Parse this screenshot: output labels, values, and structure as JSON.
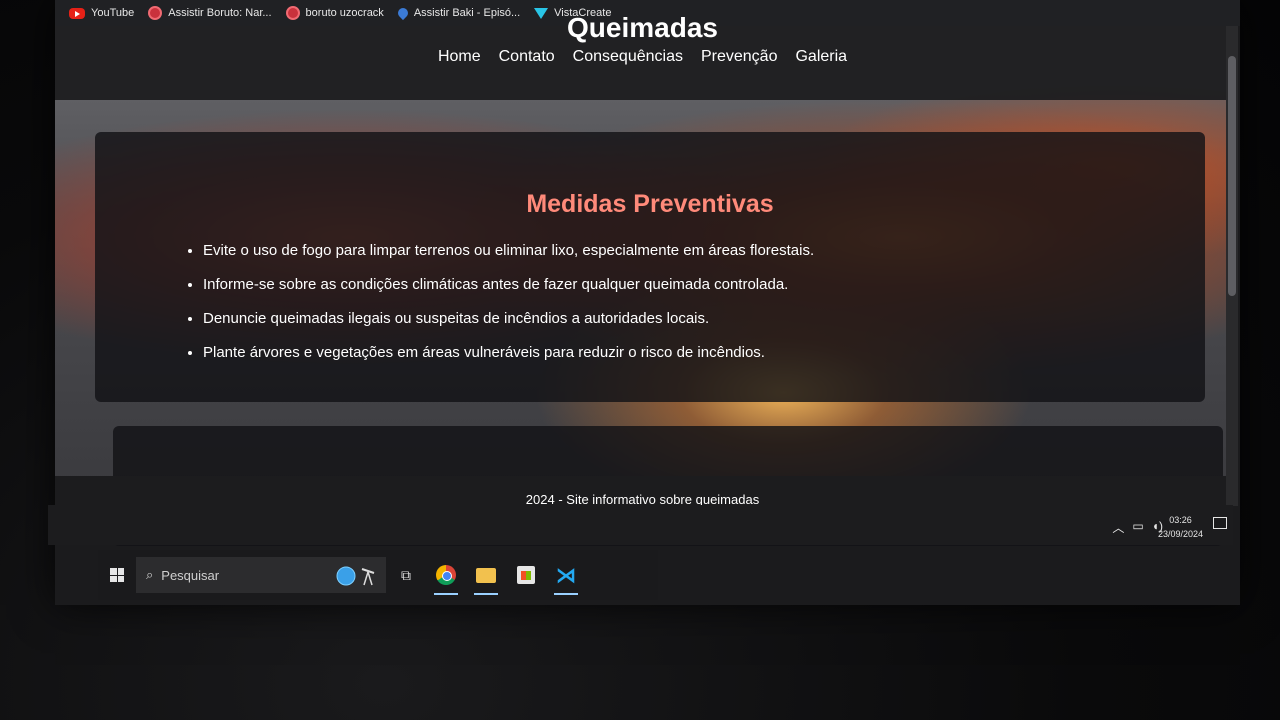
{
  "bookmarks": [
    {
      "label": "YouTube",
      "icon": "youtube-icon"
    },
    {
      "label": "Assistir Boruto: Nar...",
      "icon": "site-icon"
    },
    {
      "label": "boruto uzocrack",
      "icon": "site-icon"
    },
    {
      "label": "Assistir Baki - Episó...",
      "icon": "site-icon"
    },
    {
      "label": "VistaCreate",
      "icon": "vistacreate-icon"
    }
  ],
  "site": {
    "title": "Queimadas",
    "nav": [
      "Home",
      "Contato",
      "Consequências",
      "Prevenção",
      "Galeria"
    ],
    "section_title": "Medidas Preventivas",
    "items": [
      "Evite o uso de fogo para limpar terrenos ou eliminar lixo, especialmente em áreas florestais.",
      "Informe-se sobre as condições climáticas antes de fazer qualquer queimada controlada.",
      "Denuncie queimadas ilegais ou suspeitas de incêndios a autoridades locais.",
      "Plante árvores e vegetações em áreas vulneráveis para reduzir o risco de incêndios."
    ],
    "footer": "2024 - Site informativo sobre queimadas",
    "accent_color": "#ff8a7a"
  },
  "taskbar": {
    "search_placeholder": "Pesquisar",
    "time": "03:26",
    "date": "23/09/2024"
  }
}
